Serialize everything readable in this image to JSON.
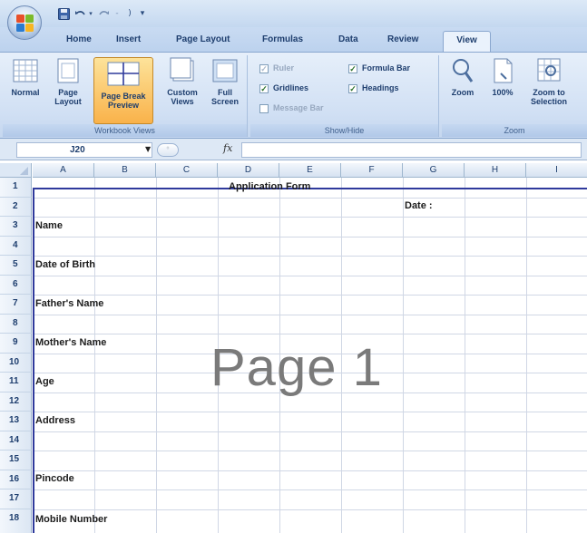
{
  "quick_access": {
    "office_button": "office-button-icon",
    "save": "save-icon",
    "undo": "undo-icon",
    "redo": "redo-icon",
    "customize": "customize-arrow-icon"
  },
  "tabs": [
    {
      "label": "Home"
    },
    {
      "label": "Insert"
    },
    {
      "label": "Page Layout"
    },
    {
      "label": "Formulas"
    },
    {
      "label": "Data"
    },
    {
      "label": "Review"
    },
    {
      "label": "View",
      "active": true
    }
  ],
  "ribbon": {
    "workbook_views": {
      "label": "Workbook Views",
      "normal": {
        "line1": "Normal",
        "line2": ""
      },
      "page_layout": {
        "line1": "Page",
        "line2": "Layout"
      },
      "page_break_preview": {
        "line1": "Page Break",
        "line2": "Preview"
      },
      "custom_views": {
        "line1": "Custom",
        "line2": "Views"
      },
      "full_screen": {
        "line1": "Full",
        "line2": "Screen"
      }
    },
    "show_hide": {
      "label": "Show/Hide",
      "ruler": {
        "label": "Ruler",
        "checked": true,
        "enabled": false
      },
      "gridlines": {
        "label": "Gridlines",
        "checked": true,
        "enabled": true
      },
      "message_bar": {
        "label": "Message Bar",
        "checked": false,
        "enabled": false
      },
      "formula_bar": {
        "label": "Formula Bar",
        "checked": true,
        "enabled": true
      },
      "headings": {
        "label": "Headings",
        "checked": true,
        "enabled": true
      }
    },
    "zoom": {
      "label": "Zoom",
      "zoom": {
        "line1": "Zoom",
        "line2": ""
      },
      "hundred": {
        "line1": "100%",
        "line2": ""
      },
      "zoom_to_selection": {
        "line1": "Zoom to",
        "line2": "Selection"
      }
    }
  },
  "formula_bar": {
    "name_box": "J20",
    "fx": "fx",
    "content": ""
  },
  "sheet": {
    "columns": [
      "A",
      "B",
      "C",
      "D",
      "E",
      "F",
      "G",
      "H",
      "I"
    ],
    "rows": [
      "1",
      "2",
      "3",
      "4",
      "5",
      "6",
      "7",
      "8",
      "9",
      "10",
      "11",
      "12",
      "13",
      "14",
      "15",
      "16",
      "17",
      "18"
    ],
    "cells": {
      "title": "Application Form",
      "date": "Date :",
      "name": "Name",
      "dob": "Date of Birth",
      "father": "Father's Name",
      "mother": "Mother's Name",
      "age": "Age",
      "address": "Address",
      "pincode": "Pincode",
      "mobile": "Mobile Number"
    },
    "watermark": "Page 1"
  },
  "colors": {
    "page_break_border": "#2f3a9c",
    "active_button": "#f9b24a",
    "ribbon_bg": "#d1e0f4"
  }
}
